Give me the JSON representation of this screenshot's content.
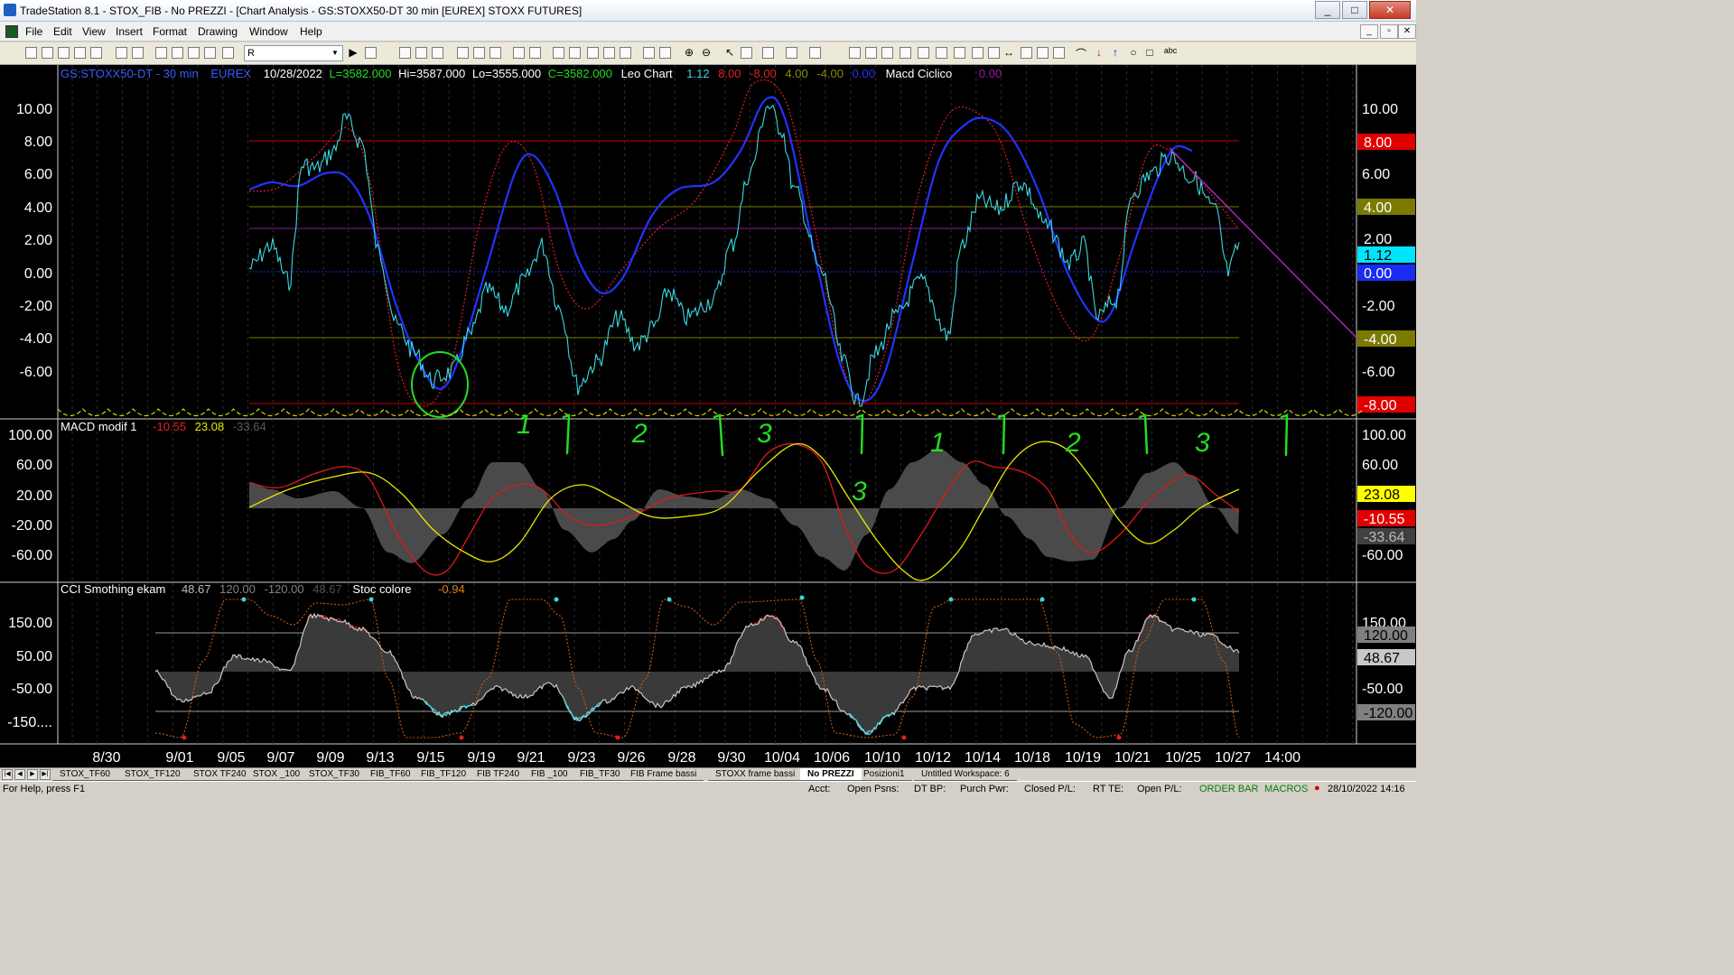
{
  "window": {
    "title": "TradeStation 8.1 - STOX_FIB - No PREZZI - [Chart Analysis - GS:STOXX50-DT  30 min  [EUREX] STOXX FUTURES]",
    "minimize": "_",
    "maximize": "□",
    "close": "✕"
  },
  "menu": {
    "items": [
      "File",
      "Edit",
      "View",
      "Insert",
      "Format",
      "Drawing",
      "Window",
      "Help"
    ],
    "mdi_buttons": [
      "_",
      "▫",
      "✕"
    ]
  },
  "toolbar": {
    "symbol_value": "R"
  },
  "chart": {
    "header": {
      "symbol": "GS:STOXX50-DT - 30 min",
      "exchange": "EUREX",
      "date": "10/28/2022",
      "last": "L=3582.000",
      "high": "Hi=3587.000",
      "low": "Lo=3555.000",
      "close": "C=3582.000",
      "study_name": "Leo Chart",
      "v1": "1.12",
      "v2": "8.00",
      "v3": "-8.00",
      "v4": "4.00",
      "v5": "-4.00",
      "v6": "0.00",
      "study2_name": "Macd Ciclico",
      "v7": "0.00"
    },
    "panel1": {
      "left_ticks": [
        "10.00",
        "8.00",
        "6.00",
        "4.00",
        "2.00",
        "0.00",
        "-2.00",
        "-4.00",
        "-6.00"
      ],
      "right_ticks": [
        "10.00",
        "6.00",
        "-2.00",
        "-6.00"
      ],
      "right_labels": [
        {
          "text": "8.00",
          "bg": "#e00000",
          "fg": "#ffffff"
        },
        {
          "text": "4.00",
          "bg": "#7a7a00",
          "fg": "#ffffff"
        },
        {
          "text": "2.00",
          "bg": "#000000",
          "fg": "#ffffff"
        },
        {
          "text": "1.12",
          "bg": "#00e5ff",
          "fg": "#000000"
        },
        {
          "text": "0.00",
          "bg": "#1a2cf0",
          "fg": "#ffffff"
        },
        {
          "text": "-4.00",
          "bg": "#7a7a00",
          "fg": "#ffffff"
        },
        {
          "text": "-8.00",
          "bg": "#e00000",
          "fg": "#ffffff"
        }
      ]
    },
    "panel2": {
      "title": "MACD modif 1",
      "v1": "-10.55",
      "v2": "23.08",
      "v3": "-33.64",
      "left_ticks": [
        "100.00",
        "60.00",
        "20.00",
        "-20.00",
        "-60.00"
      ],
      "right_ticks": [
        "100.00",
        "60.00",
        "-60.00"
      ],
      "right_labels": [
        {
          "text": "23.08",
          "bg": "#ffff00",
          "fg": "#000000"
        },
        {
          "text": "-10.55",
          "bg": "#e00000",
          "fg": "#ffffff"
        },
        {
          "text": "-33.64",
          "bg": "#404040",
          "fg": "#bbbbbb"
        }
      ],
      "handwriting": [
        "1",
        "2",
        "3",
        "3",
        "1",
        "2",
        "3"
      ]
    },
    "panel3": {
      "title": "CCI Smothing ekam",
      "v1": "48.67",
      "v2": "120.00",
      "v3": "-120.00",
      "v4": "48.67",
      "study2_name": "Stoc colore",
      "v5": "-0.94",
      "left_ticks": [
        "150.00",
        "50.00",
        "-50.00",
        "-150...."
      ],
      "right_ticks": [
        "150.00",
        "-50.00"
      ],
      "right_labels": [
        {
          "text": "120.00",
          "bg": "#808080",
          "fg": "#000000"
        },
        {
          "text": "48.67",
          "bg": "#c8c8c8",
          "fg": "#000000"
        },
        {
          "text": "-120.00",
          "bg": "#808080",
          "fg": "#000000"
        }
      ]
    },
    "x_ticks": [
      "8/30",
      "9/01",
      "9/05",
      "9/07",
      "9/09",
      "9/13",
      "9/15",
      "9/19",
      "9/21",
      "9/23",
      "9/26",
      "9/28",
      "9/30",
      "10/04",
      "10/06",
      "10/10",
      "10/12",
      "10/14",
      "10/18",
      "10/19",
      "10/21",
      "10/25",
      "10/27",
      "14:00"
    ],
    "colors": {
      "price": "#3ad8e0",
      "cycle": "#2222ff",
      "dotted": "#e02020",
      "macd_red": "#e01818",
      "macd_yellow": "#e8e800",
      "hist": "#4a4a4a",
      "trend": "#b02ac0",
      "annot": "#22dd22"
    }
  },
  "tabs": [
    "STOX_TF60",
    "STOX_TF120",
    "STOX TF240",
    "STOX _100",
    "STOX_TF30",
    "FIB_TF60",
    "FIB_TF120",
    "FIB TF240",
    "FIB _100",
    "FIB_TF30",
    "FIB Frame bassi",
    "STOXX frame bassi",
    "No PREZZI",
    "Posizioni1",
    "Untitled Workspace: 6"
  ],
  "active_tab": "No PREZZI",
  "status": {
    "help": "For Help, press F1",
    "acct": "Acct:",
    "open_psns": "Open Psns:",
    "dt_bp": "DT BP:",
    "purch_pwr": "Purch Pwr:",
    "closed_pl": "Closed P/L:",
    "rt_te": "RT TE:",
    "open_pl": "Open P/L:",
    "order_bar": "ORDER BAR",
    "macros": "MACROS",
    "datetime": "28/10/2022 14:16"
  }
}
